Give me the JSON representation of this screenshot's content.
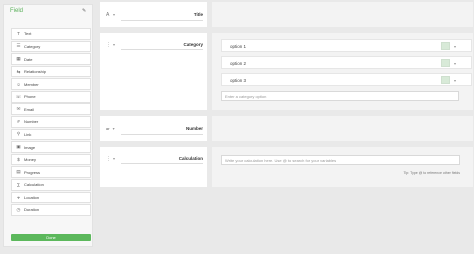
{
  "sidebar": {
    "title": "Field",
    "items": [
      {
        "label": "Text",
        "icon": "text-icon",
        "glyph": "T"
      },
      {
        "label": "Category",
        "icon": "category-icon",
        "glyph": "☰"
      },
      {
        "label": "Date",
        "icon": "calendar-icon",
        "glyph": "▦"
      },
      {
        "label": "Relationship",
        "icon": "relationship-icon",
        "glyph": "⇆"
      },
      {
        "label": "Member",
        "icon": "member-icon",
        "glyph": "☺"
      },
      {
        "label": "Phone",
        "icon": "phone-icon",
        "glyph": "☏"
      },
      {
        "label": "Email",
        "icon": "email-icon",
        "glyph": "✉"
      },
      {
        "label": "Number",
        "icon": "number-icon",
        "glyph": "#"
      },
      {
        "label": "Link",
        "icon": "link-icon",
        "glyph": "⚲"
      },
      {
        "label": "Image",
        "icon": "image-icon",
        "glyph": "▣"
      },
      {
        "label": "Money",
        "icon": "money-icon",
        "glyph": "$"
      },
      {
        "label": "Progress",
        "icon": "progress-icon",
        "glyph": "▤"
      },
      {
        "label": "Calculation",
        "icon": "calculation-icon",
        "glyph": "∑"
      },
      {
        "label": "Location",
        "icon": "location-icon",
        "glyph": "⌖"
      },
      {
        "label": "Duration",
        "icon": "duration-icon",
        "glyph": "◷"
      }
    ],
    "done_label": "Done"
  },
  "fields": {
    "title": {
      "label": "Title",
      "selector": "A"
    },
    "category": {
      "label": "Category",
      "options": [
        "option 1",
        "option 2",
        "option 3"
      ],
      "add_placeholder": "Enter a category option"
    },
    "number": {
      "prefix": "or",
      "label": "Number"
    },
    "calculation": {
      "label": "Calculation",
      "placeholder": "Write your calculation here. Use @ to search for your variables",
      "tip": "Tip: Type @ to reference other fields"
    }
  },
  "colors": {
    "accent": "#5cb85c",
    "swatch": "#d8ead8"
  }
}
